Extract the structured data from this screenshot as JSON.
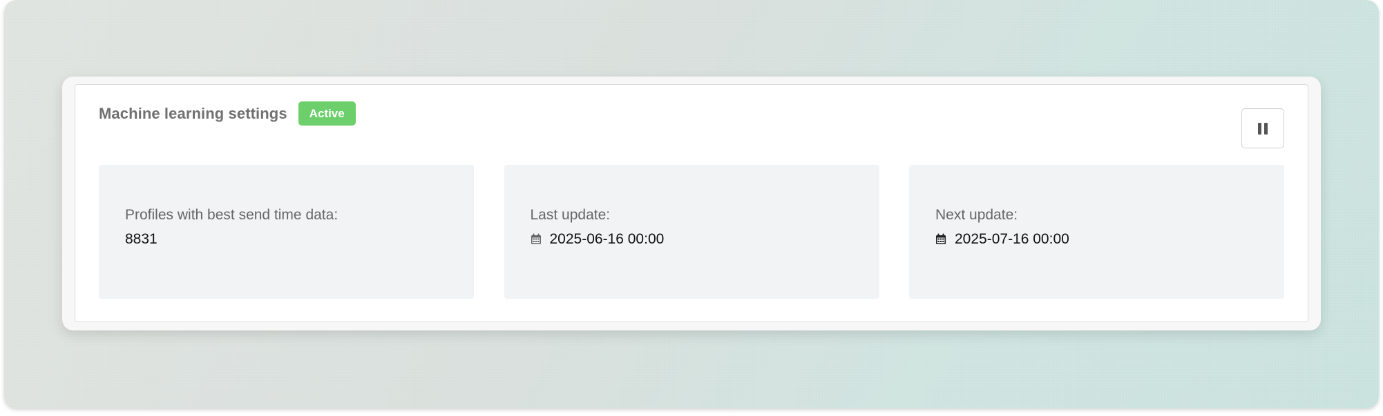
{
  "card": {
    "title": "Machine learning settings",
    "status_badge": "Active",
    "pause_button_icon": "pause-icon"
  },
  "stats": [
    {
      "label": "Profiles with best send time data:",
      "value": "8831",
      "icon": null
    },
    {
      "label": "Last update:",
      "value": "2025-06-16 00:00",
      "icon": "calendar-icon",
      "icon_color": "#666666"
    },
    {
      "label": "Next update:",
      "value": "2025-07-16 00:00",
      "icon": "calendar-icon",
      "icon_color": "#222222"
    }
  ],
  "colors": {
    "badge_green": "#6ccf6c",
    "title_gray": "#707070",
    "panel_bg": "#f2f3f4"
  }
}
